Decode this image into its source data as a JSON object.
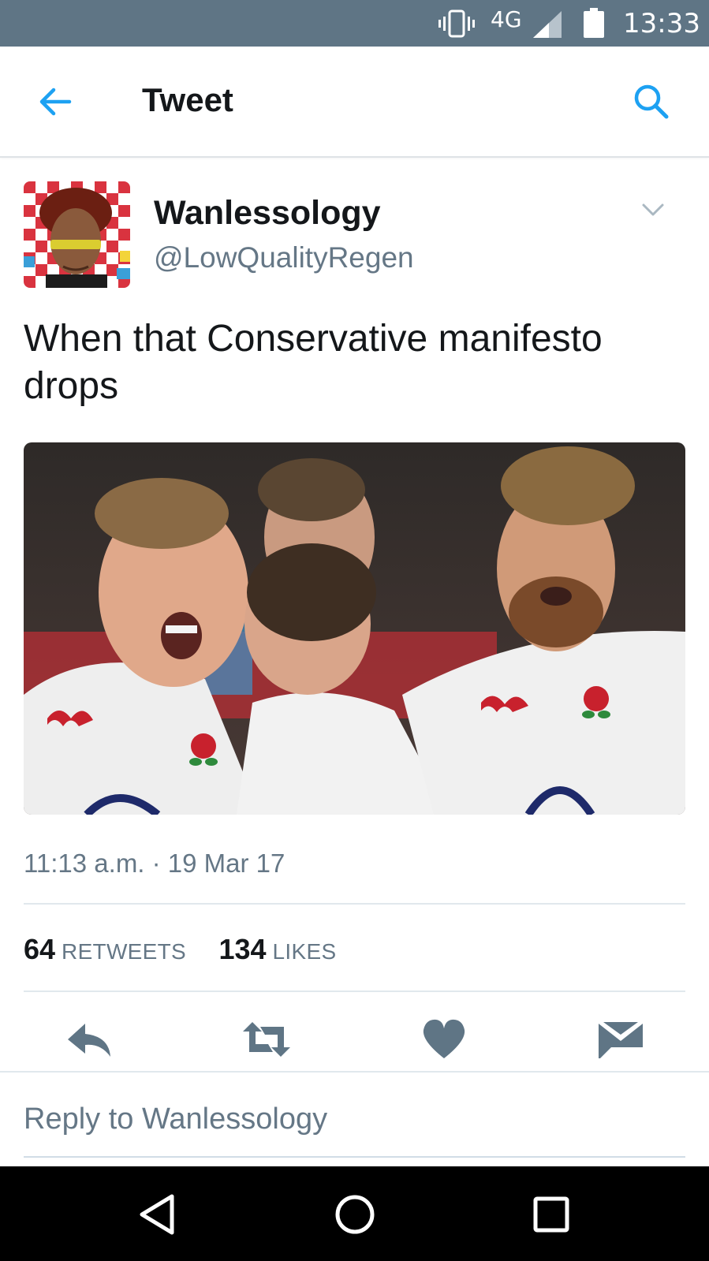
{
  "status_bar": {
    "network": "4G",
    "time": "13:33",
    "color": "#5f7585"
  },
  "header": {
    "title": "Tweet",
    "back_icon": "arrow-left-icon",
    "search_icon": "search-icon",
    "accent": "#1da1f2"
  },
  "tweet": {
    "author_name": "Wanlessology",
    "author_handle": "@LowQualityRegen",
    "text": "When that Conservative manifesto drops",
    "timestamp": "11:13 a.m. · 19 Mar 17",
    "media_alt": "Rugby players in white shirts celebrating",
    "stats": {
      "retweets_count": "64",
      "retweets_label": "RETWEETS",
      "likes_count": "134",
      "likes_label": "LIKES"
    },
    "actions": [
      "reply-icon",
      "retweet-icon",
      "heart-icon",
      "message-icon"
    ]
  },
  "reply": {
    "placeholder": "Reply to Wanlessology"
  },
  "nav_bar": {
    "buttons": [
      "back-triangle-icon",
      "home-circle-icon",
      "recents-square-icon"
    ]
  },
  "colors": {
    "text_primary": "#14171a",
    "text_secondary": "#657786",
    "icon_gray": "#5f7585",
    "divider": "#e1e8ed"
  }
}
